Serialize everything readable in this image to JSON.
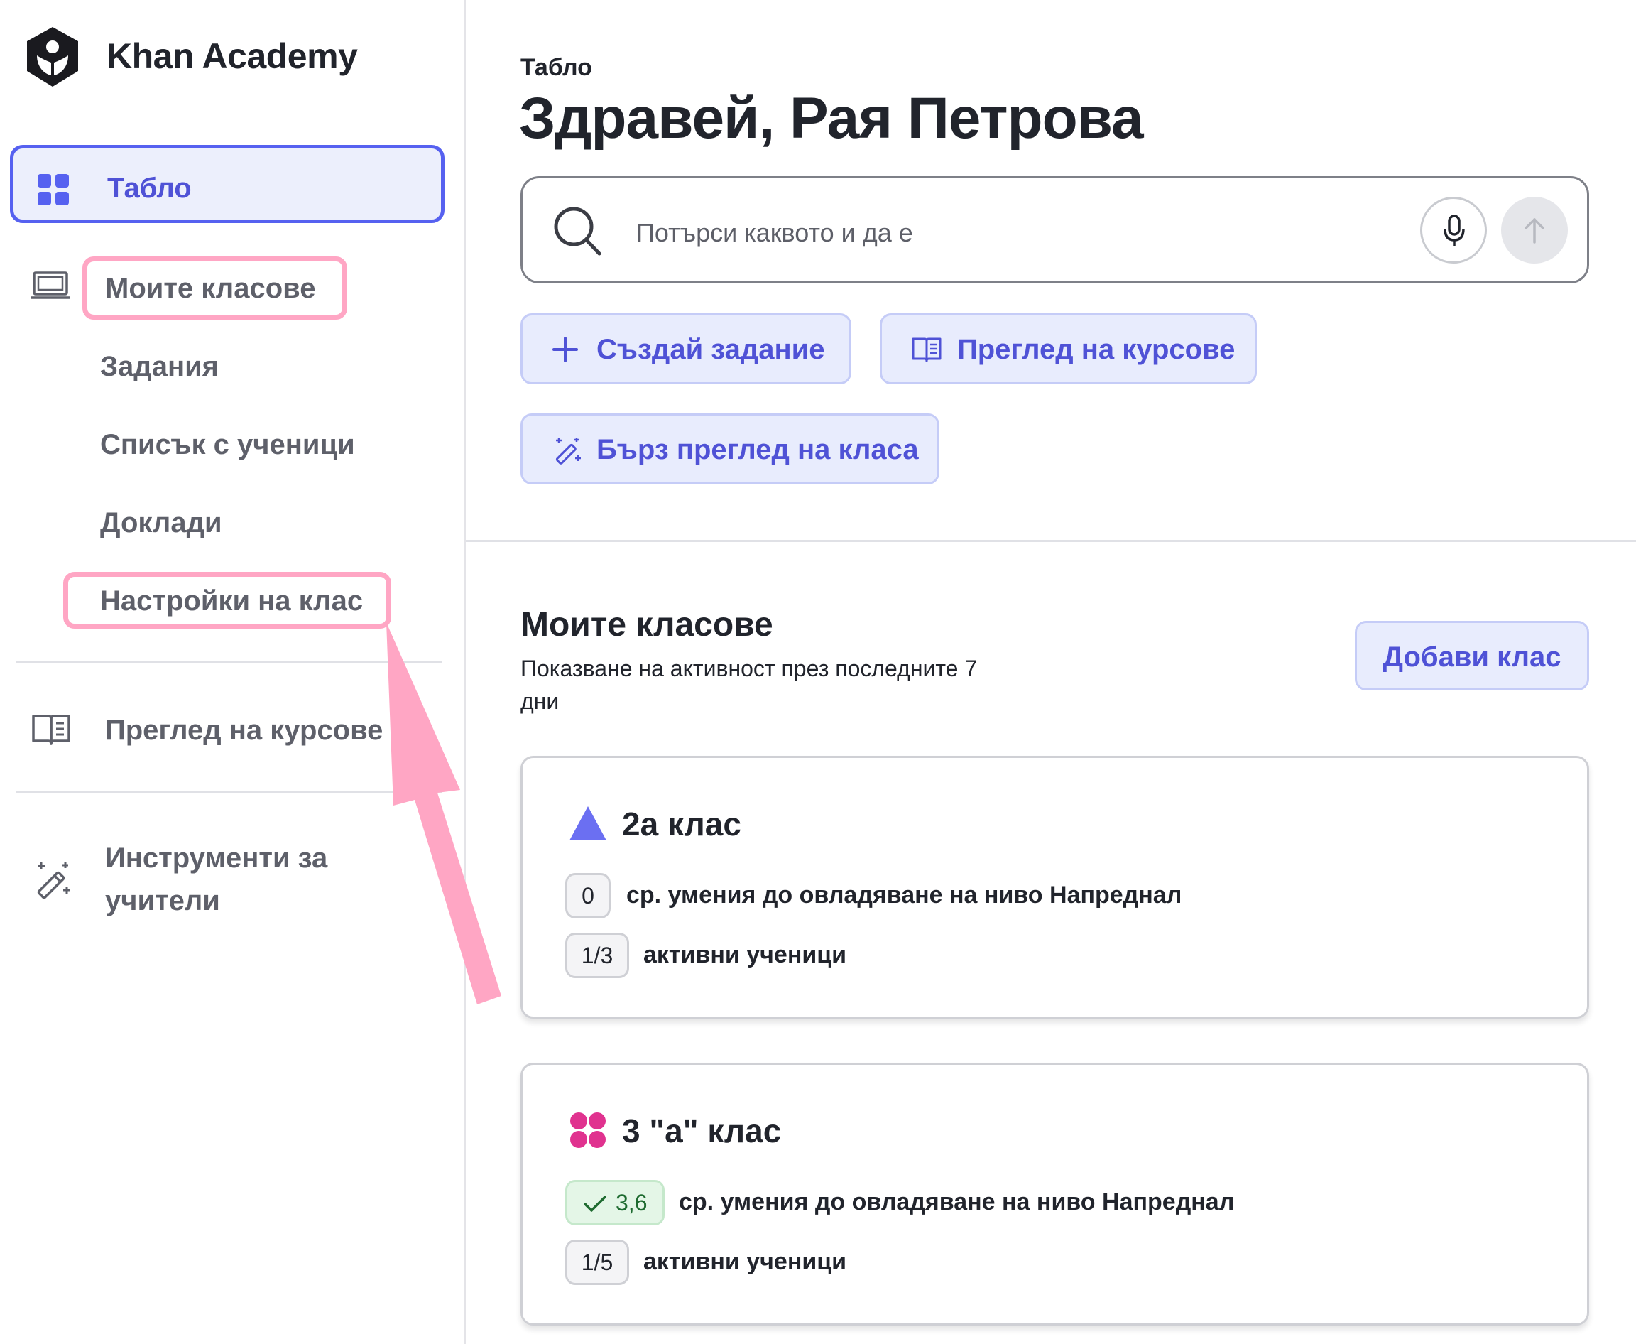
{
  "sidebar": {
    "logo_text": "Khan Academy",
    "dashboard_label": "Табло",
    "my_classes_label": "Моите класове",
    "assignments_label": "Задания",
    "roster_label": "Списък с ученици",
    "reports_label": "Доклади",
    "class_settings_label": "Настройки на клас",
    "browse_courses_label": "Преглед на курсове",
    "teacher_tools_line1": "Инструменти за",
    "teacher_tools_line2": "учители"
  },
  "header": {
    "breadcrumb": "Табло",
    "greeting": "Здравей, Рая Петрова"
  },
  "search": {
    "placeholder": "Потърси каквото и да е"
  },
  "actions": {
    "create_assignment": "Създай задание",
    "browse_courses": "Преглед на курсове",
    "quick_class_review": "Бърз преглед на класа"
  },
  "classes_section": {
    "title": "Моите класове",
    "subtitle": "Показване на активност през последните 7 дни",
    "add_class_label": "Добави клас",
    "classes": [
      {
        "name": "2а клас",
        "icon": "triangle-icon",
        "icon_color": "#6b6ff2",
        "mastery_value": "0",
        "mastery_label": "ср. умения до овладяване на ниво Напреднал",
        "active_value": "1/3",
        "active_label": "активни ученици"
      },
      {
        "name": "3 \"а\" клас",
        "icon": "flower-icon",
        "icon_color": "#e0328f",
        "mastery_value": "3,6",
        "mastery_label": "ср. умения до овладяване на ниво Напреднал",
        "active_value": "1/5",
        "active_label": "активни ученици"
      }
    ]
  },
  "colors": {
    "accent": "#4f52d6",
    "highlight_annotation": "#ffa6c4",
    "pill_background": "#e8ecfd"
  }
}
